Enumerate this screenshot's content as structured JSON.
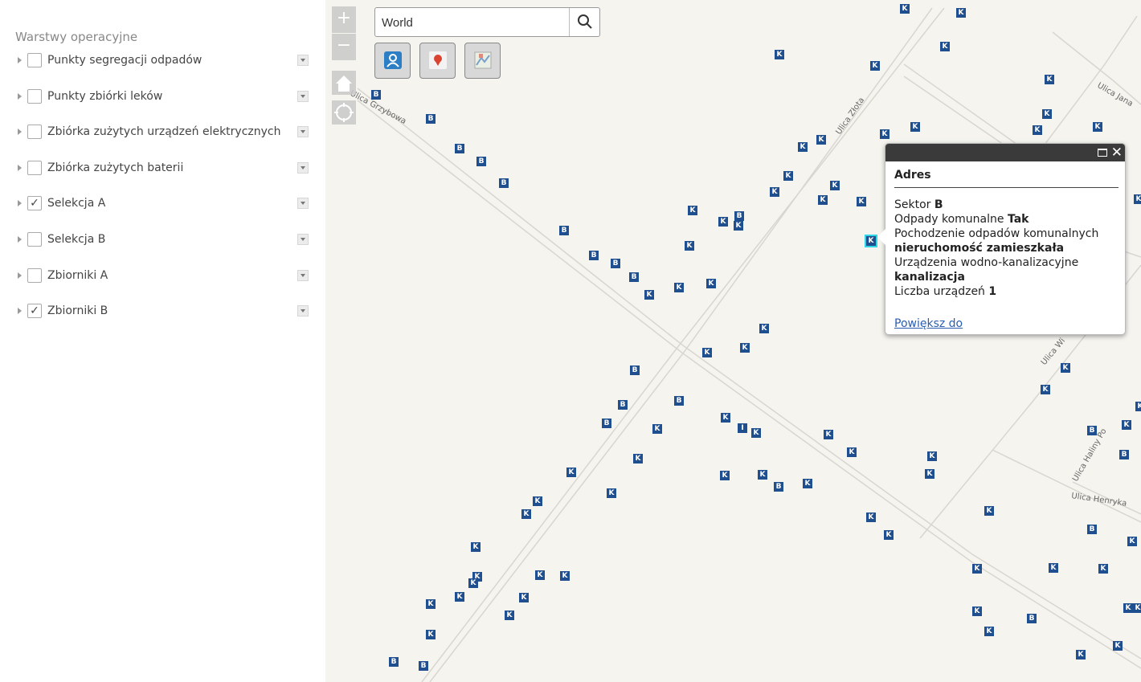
{
  "sidebar": {
    "title": "Warstwy operacyjne",
    "layers": [
      {
        "label": "Punkty segregacji odpadów",
        "checked": false
      },
      {
        "label": "Punkty zbiórki leków",
        "checked": false
      },
      {
        "label": "Zbiórka zużytych urządzeń elektrycznych",
        "checked": false
      },
      {
        "label": "Zbiórka zużytych baterii",
        "checked": false
      },
      {
        "label": "Selekcja A",
        "checked": true
      },
      {
        "label": "Selekcja B",
        "checked": false
      },
      {
        "label": "Zbiorniki A",
        "checked": false
      },
      {
        "label": "Zbiorniki B",
        "checked": true
      }
    ],
    "check_mark": "✓"
  },
  "map": {
    "zoom_in": "+",
    "zoom_out": "−",
    "search": {
      "value": "World"
    },
    "streets": [
      "Ulica Grzybowa",
      "Ulica Złota",
      "Ulica Jana",
      "Ulica Wi",
      "Ulica Haliny Po",
      "Ulica Henryka"
    ],
    "marker_letters": {
      "k": "K",
      "b": "B",
      "i": "I"
    }
  },
  "popup": {
    "title": "Adres",
    "fields": [
      {
        "label": "Sektor",
        "value": "B"
      },
      {
        "label": "Odpady komunalne",
        "value": "Tak"
      },
      {
        "label": "Pochodzenie odpadów komunalnych",
        "value": "nieruchomość zamieszkała"
      },
      {
        "label": "Urządzenia wodno-kanalizacyjne",
        "value": "kanalizacja"
      },
      {
        "label": "Liczba urządzeń",
        "value": "1"
      }
    ],
    "zoom_link": "Powiększ do",
    "close": "✕"
  },
  "colors": {
    "marker": "#1f4f8f",
    "selected_outline": "#2ed6e6",
    "popup_header": "#3a3a3a",
    "link": "#2a5db0"
  }
}
